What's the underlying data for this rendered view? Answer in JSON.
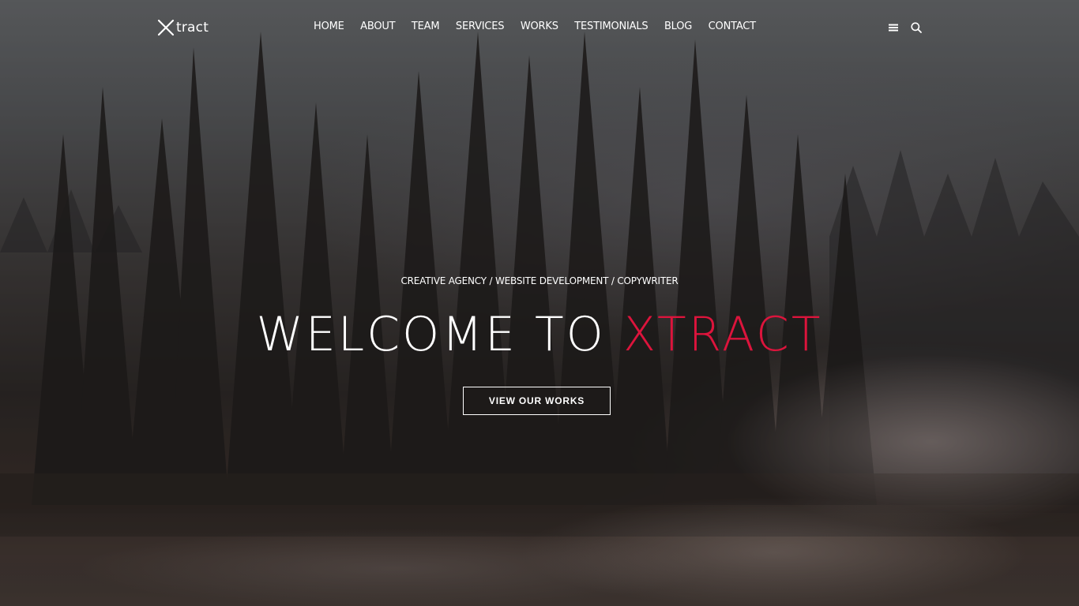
{
  "header": {
    "logo_text": "tract",
    "nav": [
      {
        "label": "HOME"
      },
      {
        "label": "ABOUT"
      },
      {
        "label": "TEAM"
      },
      {
        "label": "SERVICES"
      },
      {
        "label": "WORKS"
      },
      {
        "label": "TESTIMONIALS"
      },
      {
        "label": "BLOG"
      },
      {
        "label": "CONTACT"
      }
    ],
    "icons": [
      "menu-icon",
      "search-icon"
    ]
  },
  "hero": {
    "tagline": "CREATIVE AGENCY / WEBSITE DEVELOPMENT / COPYWRITER",
    "headline_part1": "WELCOME TO ",
    "headline_part2": "XTRACT",
    "cta_label": "VIEW OUR WORKS"
  },
  "colors": {
    "accent": "#dc143c",
    "text": "#ffffff"
  }
}
